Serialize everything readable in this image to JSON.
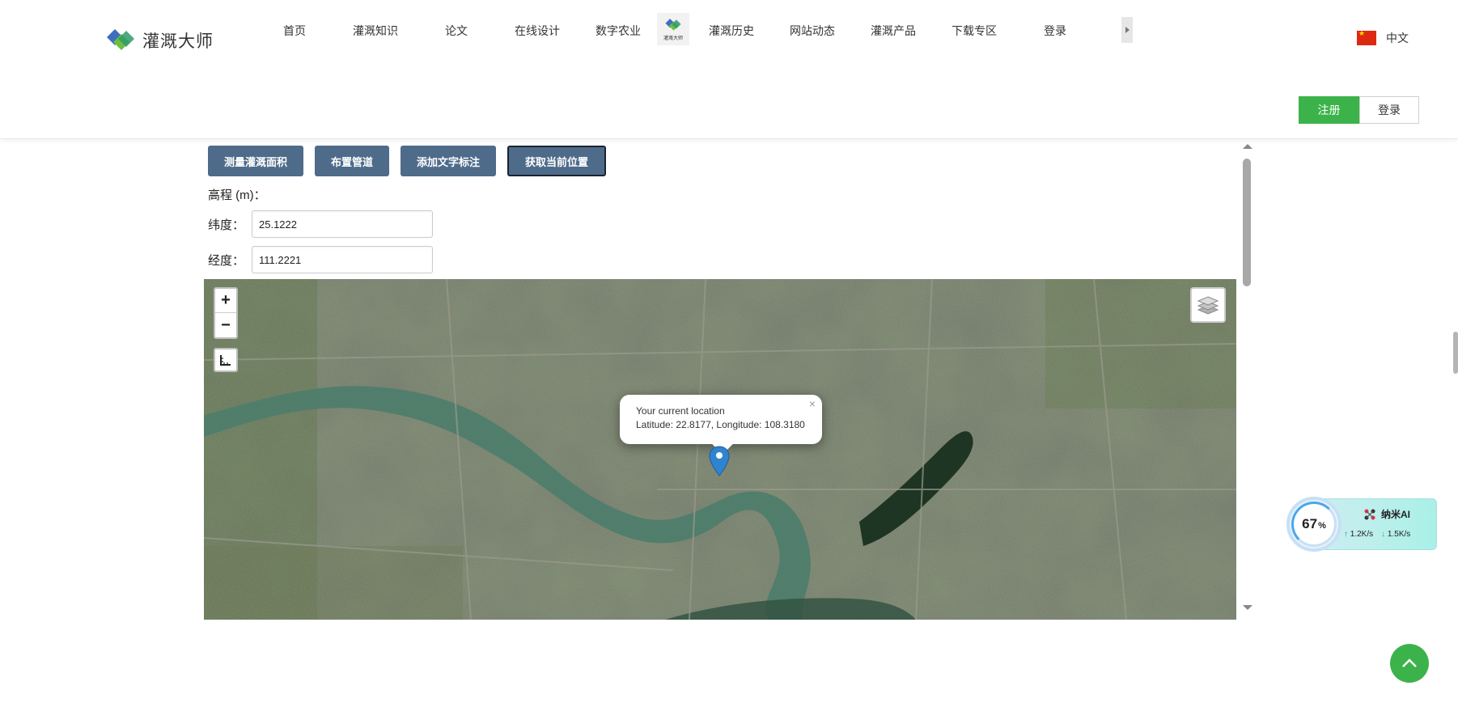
{
  "brand": {
    "name": "灌溉大师"
  },
  "nav": {
    "items": [
      {
        "label": "首页"
      },
      {
        "label": "灌溉知识"
      },
      {
        "label": "论文"
      },
      {
        "label": "在线设计"
      },
      {
        "label": "数字农业"
      },
      {
        "label": "灌溉历史"
      },
      {
        "label": "网站动态"
      },
      {
        "label": "灌溉产品"
      },
      {
        "label": "下载专区"
      },
      {
        "label": "登录"
      }
    ],
    "badge_text": "灌溉大师"
  },
  "language": {
    "label": "中文"
  },
  "auth": {
    "register_label": "注册",
    "login_label": "登录"
  },
  "toolbar": {
    "buttons": [
      {
        "label": "测量灌溉面积"
      },
      {
        "label": "布置管道"
      },
      {
        "label": "添加文字标注"
      },
      {
        "label": "获取当前位置"
      }
    ]
  },
  "form": {
    "elevation_label": "高程 (m)：",
    "latitude_label": "纬度：",
    "latitude_value": "25.1222",
    "longitude_label": "经度：",
    "longitude_value": "111.2221"
  },
  "map": {
    "zoom_in": "+",
    "zoom_out": "−",
    "popup_close": "×",
    "popup_title": "Your current location",
    "popup_coords": "Latitude: 22.8177, Longitude: 108.3180"
  },
  "ai_widget": {
    "percent": "67",
    "percent_unit": "%",
    "name": "纳米AI",
    "upload": "1.2K/s",
    "download": "1.5K/s"
  },
  "colors": {
    "primary_green": "#3cb34a",
    "tool_button": "#4e6b8a",
    "river": "#4f7d6c"
  }
}
